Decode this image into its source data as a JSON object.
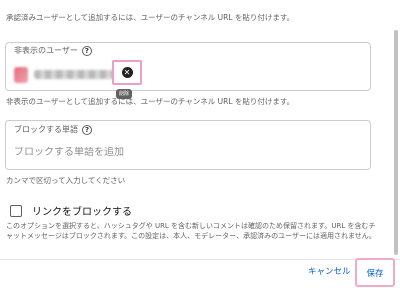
{
  "top_hint": "承認済みユーザーとして追加するには、ユーザーのチャンネル URL を貼り付けます。",
  "hidden_users": {
    "label": "非表示のユーザー",
    "help_icon": "?",
    "chip_remove_glyph": "✕",
    "tooltip": "削除",
    "hint": "非表示のユーザーとして追加するには、ユーザーのチャンネル URL を貼り付けます。"
  },
  "blocked_words": {
    "label": "ブロックする単語",
    "help_icon": "?",
    "placeholder": "ブロックする単語を追加",
    "hint": "カンマで区切って入力してください"
  },
  "block_links": {
    "label": "リンクをブロックする",
    "checked": false,
    "description": "このオプションを選択すると、ハッシュタグや URL を含む新しいコメントは確認のため保留されます。URL を含むチャットメッセージはブロックされます。この設定は、本人、モデレーター、承認済みのユーザーには適用されません。"
  },
  "footer": {
    "cancel_label": "キャンセル",
    "save_label": "保存"
  }
}
